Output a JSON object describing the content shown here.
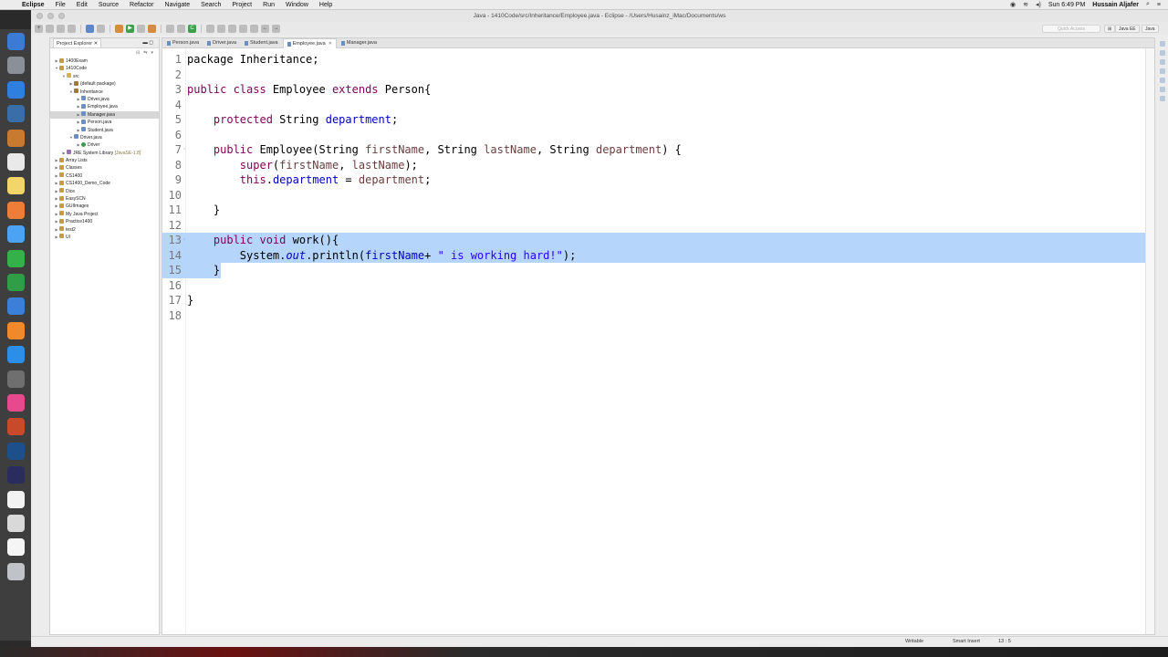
{
  "menubar": {
    "app": "Eclipse",
    "items": [
      "File",
      "Edit",
      "Source",
      "Refactor",
      "Navigate",
      "Search",
      "Project",
      "Run",
      "Window",
      "Help"
    ],
    "clock": "Sun 6:49 PM",
    "user": "Hussain Aljafer"
  },
  "window": {
    "title": "Java - 1410Code/src/Inheritance/Employee.java - Eclipse - /Users/Husainz_iMac/Documents/ws",
    "quick_access": "Quick Access",
    "perspectives": [
      "Java EE",
      "Java"
    ]
  },
  "explorer": {
    "tab_label": "Project Explorer",
    "tree": [
      {
        "label": "1400Exam",
        "icon": "project-icon",
        "arrow": "▶",
        "depth": 0
      },
      {
        "label": "1410Code",
        "icon": "project-icon",
        "arrow": "▼",
        "depth": 0
      },
      {
        "label": "src",
        "icon": "folder-icon",
        "arrow": "▼",
        "depth": 1
      },
      {
        "label": "(default package)",
        "icon": "package-icon",
        "arrow": "▶",
        "depth": 2
      },
      {
        "label": "Inheritance",
        "icon": "package-icon",
        "arrow": "▼",
        "depth": 2
      },
      {
        "label": "Driver.java",
        "icon": "java-file-icon",
        "arrow": "▶",
        "depth": 3
      },
      {
        "label": "Employee.java",
        "icon": "java-file-icon",
        "arrow": "▶",
        "depth": 3
      },
      {
        "label": "Manager.java",
        "icon": "java-file-icon",
        "arrow": "▶",
        "depth": 3,
        "selected": true
      },
      {
        "label": "Person.java",
        "icon": "java-file-icon",
        "arrow": "▶",
        "depth": 3
      },
      {
        "label": "Student.java",
        "icon": "java-file-icon",
        "arrow": "▶",
        "depth": 3
      },
      {
        "label": "Driver.java",
        "icon": "java-file-icon",
        "arrow": "▼",
        "depth": 2
      },
      {
        "label": "Driver",
        "icon": "class-icon",
        "arrow": "▶",
        "depth": 3
      },
      {
        "label": "JRE System Library",
        "suffix": "[JavaSE-1.8]",
        "icon": "library-icon",
        "arrow": "▶",
        "depth": 1
      },
      {
        "label": "Array Lists",
        "icon": "project-icon",
        "arrow": "▶",
        "depth": 0
      },
      {
        "label": "Classes",
        "icon": "project-icon",
        "arrow": "▶",
        "depth": 0
      },
      {
        "label": "CS1400",
        "icon": "project-icon",
        "arrow": "▶",
        "depth": 0
      },
      {
        "label": "CS1400_Demo_Code",
        "icon": "project-icon",
        "arrow": "▶",
        "depth": 0
      },
      {
        "label": "Dice",
        "icon": "project-icon",
        "arrow": "▶",
        "depth": 0
      },
      {
        "label": "EasySCN",
        "icon": "project-icon",
        "arrow": "▶",
        "depth": 0
      },
      {
        "label": "GUIImages",
        "icon": "project-icon",
        "arrow": "▶",
        "depth": 0
      },
      {
        "label": "My Java Project",
        "icon": "project-icon",
        "arrow": "▶",
        "depth": 0
      },
      {
        "label": "Practice1400",
        "icon": "project-icon",
        "arrow": "▶",
        "depth": 0
      },
      {
        "label": "test2",
        "icon": "project-icon",
        "arrow": "▶",
        "depth": 0
      },
      {
        "label": "UI",
        "icon": "project-icon",
        "arrow": "▶",
        "depth": 0
      }
    ]
  },
  "editor": {
    "tabs": [
      {
        "label": "Person.java",
        "active": false
      },
      {
        "label": "Driver.java",
        "active": false
      },
      {
        "label": "Student.java",
        "active": false
      },
      {
        "label": "Employee.java",
        "active": true
      },
      {
        "label": "Manager.java",
        "active": false
      }
    ],
    "lines": [
      {
        "n": "1",
        "tokens": [
          {
            "t": "package Inheritance;",
            "c": ""
          }
        ]
      },
      {
        "n": "2",
        "tokens": []
      },
      {
        "n": "3",
        "tokens": [
          {
            "t": "public class ",
            "c": "kw"
          },
          {
            "t": "Employee ",
            "c": ""
          },
          {
            "t": "extends ",
            "c": "kw"
          },
          {
            "t": "Person{",
            "c": ""
          }
        ]
      },
      {
        "n": "4",
        "tokens": []
      },
      {
        "n": "5",
        "tokens": [
          {
            "t": "    protected ",
            "c": "kw"
          },
          {
            "t": "String ",
            "c": ""
          },
          {
            "t": "department",
            "c": "fld"
          },
          {
            "t": ";",
            "c": ""
          }
        ]
      },
      {
        "n": "6",
        "tokens": []
      },
      {
        "n": "7",
        "fold": "◦",
        "tokens": [
          {
            "t": "    public ",
            "c": "kw"
          },
          {
            "t": "Employee(String ",
            "c": ""
          },
          {
            "t": "firstName",
            "c": "var"
          },
          {
            "t": ", String ",
            "c": ""
          },
          {
            "t": "lastName",
            "c": "var"
          },
          {
            "t": ", String ",
            "c": ""
          },
          {
            "t": "department",
            "c": "var"
          },
          {
            "t": ") {",
            "c": ""
          }
        ]
      },
      {
        "n": "8",
        "tokens": [
          {
            "t": "        super",
            "c": "kw"
          },
          {
            "t": "(",
            "c": ""
          },
          {
            "t": "firstName",
            "c": "var"
          },
          {
            "t": ", ",
            "c": ""
          },
          {
            "t": "lastName",
            "c": "var"
          },
          {
            "t": ");",
            "c": ""
          }
        ]
      },
      {
        "n": "9",
        "tokens": [
          {
            "t": "        this",
            "c": "kw"
          },
          {
            "t": ".",
            "c": ""
          },
          {
            "t": "department",
            "c": "fld"
          },
          {
            "t": " = ",
            "c": ""
          },
          {
            "t": "department",
            "c": "var"
          },
          {
            "t": ";",
            "c": ""
          }
        ]
      },
      {
        "n": "10",
        "tokens": []
      },
      {
        "n": "11",
        "tokens": [
          {
            "t": "    }",
            "c": ""
          }
        ]
      },
      {
        "n": "12",
        "tokens": []
      },
      {
        "n": "13",
        "fold": "◦",
        "sel": "full",
        "tokens": [
          {
            "t": "    public void ",
            "c": "kw"
          },
          {
            "t": "work(){",
            "c": ""
          }
        ]
      },
      {
        "n": "14",
        "sel": "full",
        "tokens": [
          {
            "t": "        System.",
            "c": ""
          },
          {
            "t": "out",
            "c": "stat"
          },
          {
            "t": ".println(",
            "c": ""
          },
          {
            "t": "firstName",
            "c": "fld"
          },
          {
            "t": "+ ",
            "c": ""
          },
          {
            "t": "\" is working hard!\"",
            "c": "str"
          },
          {
            "t": ");",
            "c": ""
          }
        ]
      },
      {
        "n": "15",
        "sel": "partial",
        "tokens": [
          {
            "t": "    }",
            "c": ""
          }
        ]
      },
      {
        "n": "16",
        "tokens": []
      },
      {
        "n": "17",
        "tokens": [
          {
            "t": "}",
            "c": ""
          }
        ]
      },
      {
        "n": "18",
        "tokens": []
      }
    ]
  },
  "statusbar": {
    "writable": "Writable",
    "insert_mode": "Smart Insert",
    "position": "13 : 5"
  },
  "dock": {
    "apps": [
      "finder-icon",
      "launchpad-icon",
      "safari-icon",
      "preview-icon",
      "notes-book-icon",
      "calendar-icon",
      "notes-icon",
      "photos-icon",
      "messages-icon",
      "facetime-icon",
      "numbers-icon",
      "keynote-icon",
      "books-icon",
      "app-store-icon",
      "system-preferences-icon",
      "itunes-icon",
      "powerpoint-icon",
      "quicktime-icon",
      "eclipse-icon",
      "documents-icon",
      "stack-icon",
      "text-file-icon",
      "trash-icon"
    ],
    "colors": [
      "#3b7bd6",
      "#8a8f98",
      "#2e7fe0",
      "#3a6ea8",
      "#c87a30",
      "#e9e9e9",
      "#f3d66a",
      "#ef7d3a",
      "#4da3f3",
      "#35b14a",
      "#2f9e46",
      "#3c7fd8",
      "#f0892a",
      "#2b8ee8",
      "#6f6f6f",
      "#e64a8c",
      "#c94a2b",
      "#1d4f8a",
      "#2a2c5e",
      "#f2f2f2",
      "#d9d9d9",
      "#f5f5f5",
      "#bfc3c8"
    ]
  }
}
